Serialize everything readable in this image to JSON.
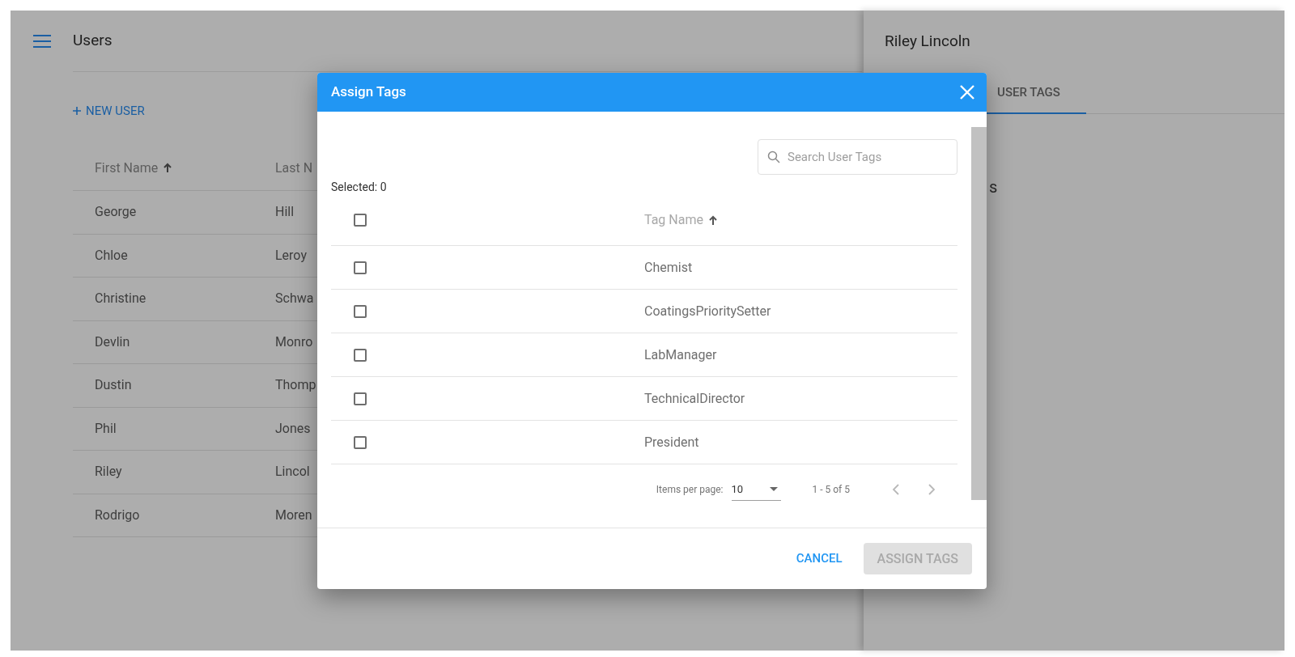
{
  "app_bar": {
    "title": "Users"
  },
  "new_user_button": {
    "label": "NEW USER"
  },
  "users_table": {
    "columns": [
      {
        "label": "First Name",
        "sorted": true
      },
      {
        "label": "Last N",
        "sorted": false
      }
    ],
    "rows": [
      {
        "first_name": "George",
        "last_name": "Hill"
      },
      {
        "first_name": "Chloe",
        "last_name": "Leroy"
      },
      {
        "first_name": "Christine",
        "last_name": "Schwa"
      },
      {
        "first_name": "Devlin",
        "last_name": "Monro"
      },
      {
        "first_name": "Dustin",
        "last_name": "Thomp"
      },
      {
        "first_name": "Phil",
        "last_name": "Jones"
      },
      {
        "first_name": "Riley",
        "last_name": "Lincol"
      },
      {
        "first_name": "Rodrigo",
        "last_name": "Moren"
      }
    ]
  },
  "detail_panel": {
    "title": "Riley Lincoln",
    "tabs": [
      {
        "label": "USER TAGS",
        "selected": true
      }
    ],
    "section_heading": "s"
  },
  "dialog": {
    "title": "Assign Tags",
    "search": {
      "placeholder": "Search User Tags"
    },
    "selected_count": "Selected: 0",
    "select_all_checked": false,
    "columns": [
      {
        "label": "Tag Name",
        "sorted": true
      }
    ],
    "rows": [
      {
        "name": "Chemist",
        "checked": false
      },
      {
        "name": "CoatingsPrioritySetter",
        "checked": false
      },
      {
        "name": "LabManager",
        "checked": false
      },
      {
        "name": "TechnicalDirector",
        "checked": false
      },
      {
        "name": "President",
        "checked": false
      }
    ],
    "pagination": {
      "items_per_page_label": "Items per page:",
      "page_size": "10",
      "range": "1 - 5 of 5",
      "prev_disabled": true,
      "next_disabled": true
    },
    "actions": [
      {
        "label": "CANCEL",
        "kind": "text",
        "disabled": false
      },
      {
        "label": "ASSIGN TAGS",
        "kind": "raised",
        "disabled": true
      }
    ]
  }
}
